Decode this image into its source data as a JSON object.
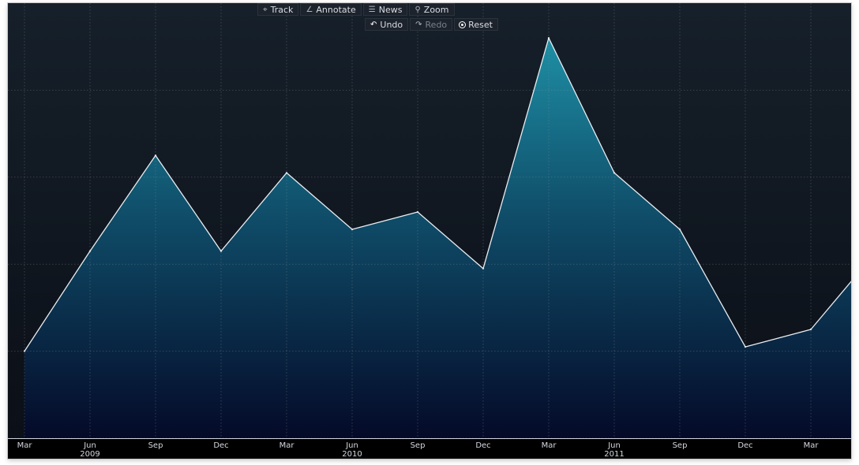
{
  "toolbar": {
    "track_label": "Track",
    "track_icon": "crosshair-icon",
    "annotate_label": "Annotate",
    "annotate_icon": "pencil-icon",
    "news_label": "News",
    "news_icon": "news-icon",
    "zoom_label": "Zoom",
    "zoom_icon": "magnifier-icon",
    "undo_label": "Undo",
    "undo_icon": "undo-arrow-icon",
    "redo_label": "Redo",
    "redo_icon": "redo-arrow-icon",
    "reset_label": "Reset",
    "reset_icon": "reset-icon"
  },
  "colors": {
    "background": "#0b0f17",
    "area_top": "#1e8fa5",
    "area_bottom": "#040a28",
    "line": "#e8edf2",
    "grid": "#8a939c",
    "axis_bar": "#000000",
    "tick_text": "#d4d8de"
  },
  "chart_data": {
    "type": "area",
    "title": "",
    "xlabel": "",
    "ylabel": "",
    "grid": true,
    "y_tick_labels_shown": false,
    "x_tick_labels": [
      "Mar",
      "Jun",
      "Sep",
      "Dec",
      "Mar",
      "Jun",
      "Sep",
      "Dec",
      "Mar",
      "Jun",
      "Sep",
      "Dec",
      "Mar"
    ],
    "x_year_labels": [
      {
        "under": "Jun",
        "index": 1,
        "label": "2009"
      },
      {
        "under": "Jun",
        "index": 5,
        "label": "2010"
      },
      {
        "under": "Jun",
        "index": 9,
        "label": "2011"
      }
    ],
    "ylim": [
      0,
      100
    ],
    "points": [
      {
        "x": "Mar 2009",
        "y": 20
      },
      {
        "x": "Jun 2009",
        "y": 43
      },
      {
        "x": "Sep 2009",
        "y": 65
      },
      {
        "x": "Dec 2009",
        "y": 43
      },
      {
        "x": "Mar 2010",
        "y": 61
      },
      {
        "x": "Jun 2010",
        "y": 48
      },
      {
        "x": "Sep 2010",
        "y": 52
      },
      {
        "x": "Dec 2010",
        "y": 39
      },
      {
        "x": "Mar 2011",
        "y": 92
      },
      {
        "x": "Jun 2011",
        "y": 61
      },
      {
        "x": "Sep 2011",
        "y": 48
      },
      {
        "x": "Dec 2011",
        "y": 21
      },
      {
        "x": "Mar 2012",
        "y": 25
      },
      {
        "x": "May 2012",
        "y": 37
      }
    ],
    "point_positions": [
      0,
      1,
      2,
      3,
      4,
      5,
      6,
      7,
      8,
      9,
      10,
      11,
      12,
      12.67
    ]
  }
}
